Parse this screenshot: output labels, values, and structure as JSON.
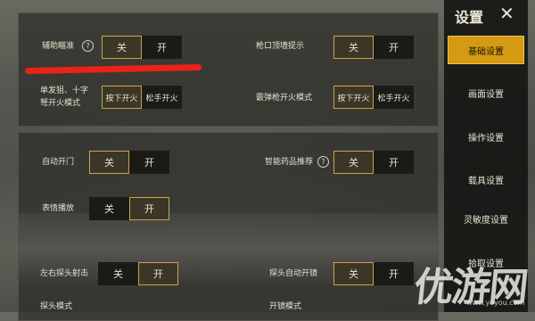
{
  "sidebar": {
    "title": "设置",
    "items": [
      {
        "label": "基础设置",
        "active": true
      },
      {
        "label": "画面设置",
        "active": false
      },
      {
        "label": "操作设置",
        "active": false
      },
      {
        "label": "载具设置",
        "active": false
      },
      {
        "label": "灵敏度设置",
        "active": false
      },
      {
        "label": "拾取设置",
        "active": false
      }
    ]
  },
  "settings": {
    "aim_assist": {
      "label": "辅助瞄准",
      "off": "关",
      "on": "开",
      "selected": "off"
    },
    "muzzle_hint": {
      "label": "枪口顶墙提示",
      "off": "关",
      "on": "开",
      "selected": "off"
    },
    "single_fire": {
      "label_line1": "单发狙、十字",
      "label_line2": "弩开火模式",
      "opt1": "按下开火",
      "opt2": "松手开火",
      "selected": "opt1"
    },
    "scatter_fire": {
      "label": "霰弹枪开火模式",
      "opt1": "按下开火",
      "opt2": "松手开火",
      "selected": "opt1"
    },
    "auto_door": {
      "label": "自动开门",
      "off": "关",
      "on": "开",
      "selected": "off"
    },
    "smart_medicine": {
      "label": "智能药品推荐",
      "off": "关",
      "on": "开",
      "selected": "off"
    },
    "emote_play": {
      "label": "表情播放",
      "off": "关",
      "on": "开",
      "selected": "on"
    },
    "lean_fire": {
      "label": "左右探头射击",
      "off": "关",
      "on": "开",
      "selected": "on"
    },
    "lean_auto_scope": {
      "label": "探头自动开镜",
      "off": "关",
      "on": "开",
      "selected": "off"
    },
    "lean_mode": {
      "label": "探头模式"
    },
    "scope_mode": {
      "label": "开镜模式"
    }
  },
  "watermark": {
    "text": "优游网",
    "url": "www.yoyou.com"
  },
  "colors": {
    "accent": "#d39a12",
    "highlight_stroke": "#ea2318",
    "selected_border": "#c8a647"
  }
}
